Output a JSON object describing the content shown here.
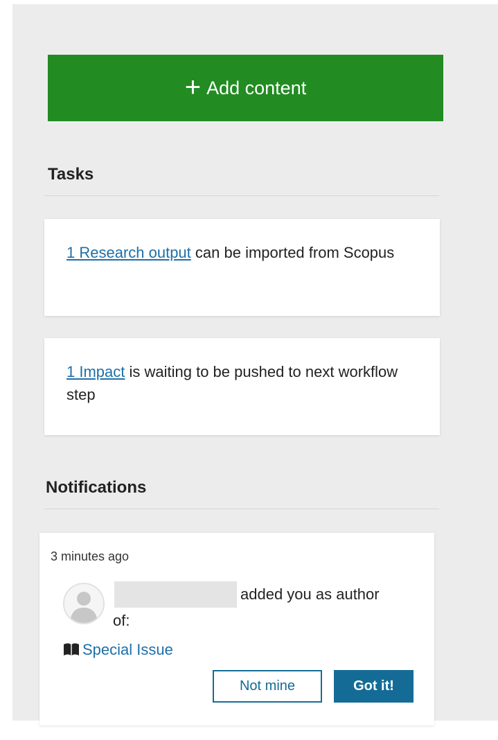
{
  "add_content": {
    "label": "Add content"
  },
  "tasks": {
    "title": "Tasks",
    "items": [
      {
        "link": "1 Research output",
        "text": "can be imported from Scopus"
      },
      {
        "link": "1 Impact",
        "text": "is waiting to be pushed to next workflow step"
      }
    ]
  },
  "notifications": {
    "title": "Notifications",
    "items": [
      {
        "timestamp": "3 minutes ago",
        "message": "added you as author",
        "message_cont": "of:",
        "item_link": "Special Issue",
        "not_mine_label": "Not mine",
        "got_it_label": "Got it!"
      }
    ]
  },
  "colors": {
    "primary_green": "#228b22",
    "link_blue": "#1e6fa8",
    "button_blue": "#146c96",
    "panel_gray": "#ececec"
  },
  "icons": {
    "add": "plus-icon",
    "avatar": "user-avatar-icon",
    "item_type": "book-icon"
  }
}
